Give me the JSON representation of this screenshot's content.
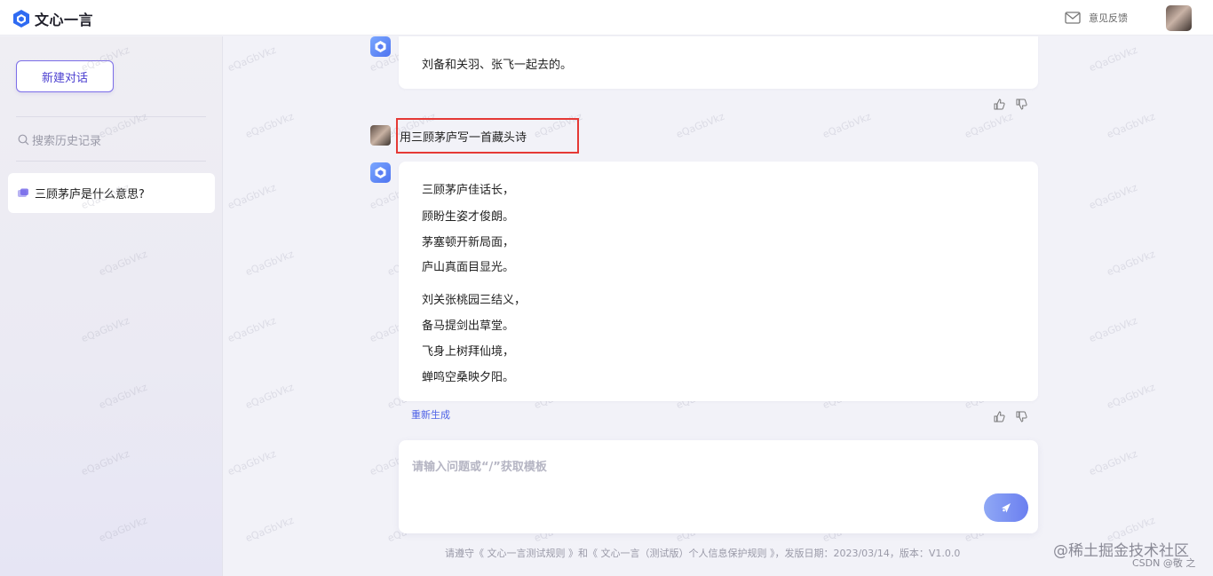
{
  "app": {
    "logo_text": "文心一言",
    "feedback_label": "意见反馈"
  },
  "sidebar": {
    "new_chat_label": "新建对话",
    "search_placeholder": "搜索历史记录",
    "history": [
      {
        "label": "三顾茅庐是什么意思?"
      }
    ]
  },
  "chat": {
    "prev_bot_reply": "刘备和关羽、张飞一起去的。",
    "user_prompt": "用三顾茅庐写一首藏头诗",
    "poem": [
      "三顾茅庐佳话长，",
      "顾盼生姿才俊朗。",
      "茅塞顿开新局面，",
      "庐山真面目显光。",
      "刘关张桃园三结义，",
      "备马提剑出草堂。",
      "飞身上树拜仙境，",
      "蝉鸣空桑映夕阳。"
    ],
    "regenerate_label": "重新生成"
  },
  "input": {
    "placeholder": "请输入问题或“/”获取模板"
  },
  "footer": {
    "text": "请遵守《 文心一言测试规则 》和《 文心一言（测试版）个人信息保护规则 》，发版日期：2023/03/14，版本：V1.0.0"
  },
  "watermarks": {
    "main": "@稀土掘金技术社区",
    "sub": "CSDN @敬 之",
    "tile": "eQaGbVkz"
  },
  "colors": {
    "accent": "#4b3fd0",
    "highlight_border": "#e53935",
    "link": "#4f63e6"
  },
  "icons": [
    "logo-mark-icon",
    "mail-icon",
    "search-icon",
    "chat-history-icon",
    "bot-avatar-icon",
    "thumbs-up-icon",
    "thumbs-down-icon",
    "send-icon"
  ]
}
